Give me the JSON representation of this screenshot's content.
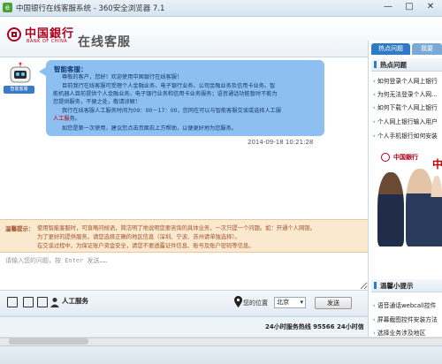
{
  "window": {
    "title": "中国银行在线客服系统 - 360安全浏览器 7.1",
    "min": "—",
    "max": "□",
    "close": "✕"
  },
  "header": {
    "logo_cn": "中国銀行",
    "logo_en": "BANK OF CHINA",
    "service_title": "在线客服"
  },
  "chat": {
    "robot_caption": "智能客服",
    "message": {
      "sender": "智能客服：",
      "lines": [
        "尊敬的客户，您好！欢迎使用中国银行在线客服！",
        "目前我行在线客服可受理个人金融业务、电子银行业务、公司金融业务及信用卡业务。智",
        "能机器人目前提供个人金融业务、电子银行业务和信用卡业务服务；语音通话功能暂时不能为",
        "您提供服务，不便之处，敬请谅解！",
        "我行在线客服人工服务时间为09：00－17：00，您同在可以与智能客服交谈或选择人工服",
        "务。",
        "如您是第一次使用，建议您点击页面右上方帮助，以便更好地为您服务。"
      ],
      "link_human": "人工服",
      "link_help": "帮助"
    },
    "timestamp": "2014-09-18 10:21:28"
  },
  "notice": {
    "label": "温馨提示：",
    "lines": [
      "使用智能客服时，可直略问候语，简洁明了地说明您要咨询的具体业务，一次只提一个问题。如：开通个人网银。",
      "为了更好的提供服务，请您选择正确的地区信息（深圳、宁波、苏州请单独选择）。",
      "在交谈过程中，为保证账户资金安全，请您不要透露证件信息、账号及账户密码等信息。"
    ]
  },
  "input": {
    "placeholder": "请输入您的问题，按 Enter 发送……"
  },
  "toolbar": {
    "human_service": "人工服务",
    "location_label": "您的位置",
    "city": "北京",
    "send": "发送"
  },
  "right_panel": {
    "tabs": [
      "热点问题",
      "我要"
    ],
    "hot_title": "热点问题",
    "hot_items": [
      "如何登录个人网上银行",
      "为何无法登录个人网...",
      "如何下载个人网上银行",
      "个人网上银行输入用户",
      "个人手机银行如何安装"
    ],
    "banner_bank": "中国銀行",
    "banner_big": "中",
    "tips_title": "温馨小提示",
    "tips_items": [
      "语音通话webcall控件",
      "屏幕截图控件安装方法",
      "选择业务涉及地区"
    ],
    "status": "24小时服务热线 95566 24小时"
  },
  "bottom_status": "24小时服务热线 95566 24小时信"
}
